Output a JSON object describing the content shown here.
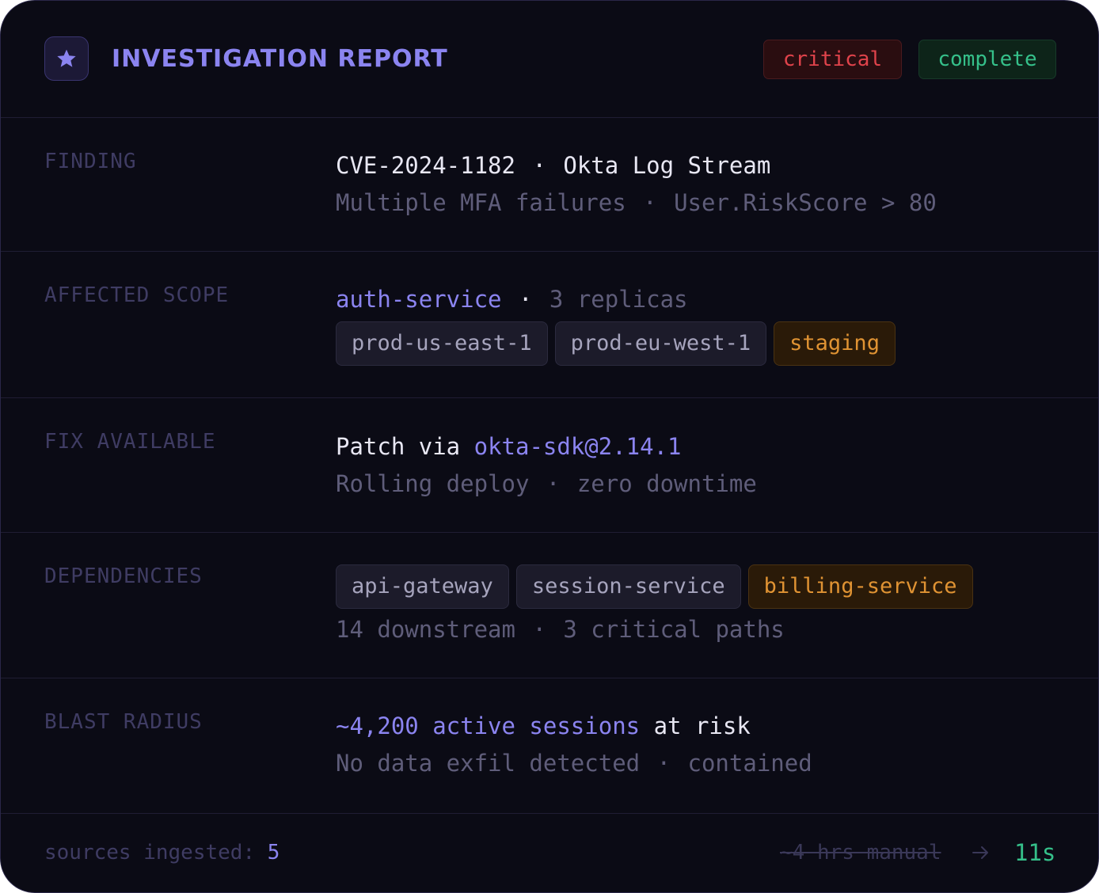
{
  "header": {
    "icon": "star-icon",
    "title": "INVESTIGATION REPORT",
    "badges": [
      {
        "label": "critical",
        "color": "#e0434b"
      },
      {
        "label": "complete",
        "color": "#35c08a"
      }
    ]
  },
  "finding": {
    "label": "FINDING",
    "cve": "CVE-2024-1182",
    "separator": "·",
    "source": "Okta Log Stream",
    "detail_a": "Multiple MFA failures",
    "detail_b": "User.RiskScore > 80"
  },
  "scope": {
    "label": "AFFECTED SCOPE",
    "service": "auth-service",
    "separator": "·",
    "replicas": "3 replicas",
    "envs": [
      {
        "name": "prod-us-east-1",
        "tone": "neutral"
      },
      {
        "name": "prod-eu-west-1",
        "tone": "neutral"
      },
      {
        "name": "staging",
        "tone": "warn"
      }
    ]
  },
  "fix": {
    "label": "FIX AVAILABLE",
    "prefix": "Patch via",
    "package": "okta-sdk@2.14.1",
    "detail_a": "Rolling deploy",
    "detail_b": "zero downtime"
  },
  "dependencies": {
    "label": "DEPENDENCIES",
    "services": [
      {
        "name": "api-gateway",
        "tone": "neutral"
      },
      {
        "name": "session-service",
        "tone": "neutral"
      },
      {
        "name": "billing-service",
        "tone": "warn"
      }
    ],
    "detail_a": "14 downstream",
    "detail_b": "3 critical paths"
  },
  "blast": {
    "label": "BLAST RADIUS",
    "sessions": "~4,200 active sessions",
    "suffix": "at risk",
    "detail_a": "No data exfil detected",
    "detail_b": "contained"
  },
  "footer": {
    "sources_label": "sources ingested:",
    "sources_count": "5",
    "manual_time": "~4 hrs manual",
    "arrow_icon": "arrow-right-icon",
    "automated_time": "11s"
  },
  "colors": {
    "background": "#0b0b15",
    "accent": "#8b84f0",
    "warning": "#e09333",
    "success": "#35c08a",
    "danger": "#e0434b"
  }
}
